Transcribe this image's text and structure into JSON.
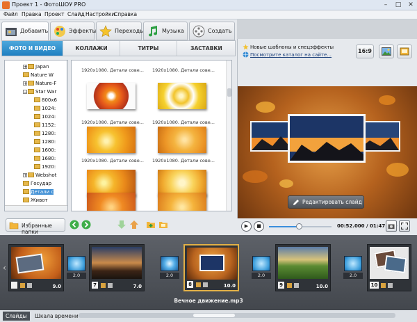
{
  "window": {
    "title": "Проект 1 - ФотоШОУ PRO",
    "min": "–",
    "max": "□",
    "close": "✕"
  },
  "menu": [
    "Файл",
    "Правка",
    "Проект",
    "Слайд",
    "Настройки",
    "Справка"
  ],
  "main_tabs": [
    {
      "label": "Добавить",
      "icon": "add-folder-icon",
      "active": true
    },
    {
      "label": "Эффекты",
      "icon": "palette-icon",
      "active": false
    },
    {
      "label": "Переходы",
      "icon": "star-icon",
      "active": false
    },
    {
      "label": "Музыка",
      "icon": "music-note-icon",
      "active": false
    },
    {
      "label": "Создать",
      "icon": "film-reel-icon",
      "active": false
    }
  ],
  "sub_tabs": [
    {
      "label": "ФОТО И ВИДЕО",
      "active": true
    },
    {
      "label": "КОЛЛАЖИ",
      "active": false
    },
    {
      "label": "ТИТРЫ",
      "active": false
    },
    {
      "label": "ЗАСТАВКИ",
      "active": false
    }
  ],
  "tree": [
    {
      "label": "Japan",
      "indent": 2,
      "toggle": "+"
    },
    {
      "label": "Nature W",
      "indent": 2,
      "toggle": ""
    },
    {
      "label": "Nature-F",
      "indent": 2,
      "toggle": "+"
    },
    {
      "label": "Star War",
      "indent": 2,
      "toggle": "−"
    },
    {
      "label": "800x6",
      "indent": 3,
      "toggle": ""
    },
    {
      "label": "1024:",
      "indent": 3,
      "toggle": ""
    },
    {
      "label": "1024:",
      "indent": 3,
      "toggle": ""
    },
    {
      "label": "1152:",
      "indent": 3,
      "toggle": ""
    },
    {
      "label": "1280:",
      "indent": 3,
      "toggle": ""
    },
    {
      "label": "1280:",
      "indent": 3,
      "toggle": ""
    },
    {
      "label": "1600:",
      "indent": 3,
      "toggle": ""
    },
    {
      "label": "1680:",
      "indent": 3,
      "toggle": ""
    },
    {
      "label": "1920:",
      "indent": 3,
      "toggle": ""
    },
    {
      "label": "Webshot",
      "indent": 2,
      "toggle": "+"
    },
    {
      "label": "Государ",
      "indent": 2,
      "toggle": ""
    },
    {
      "label": "Детали с",
      "indent": 2,
      "toggle": "",
      "selected": true
    },
    {
      "label": "Живот",
      "indent": 2,
      "toggle": ""
    }
  ],
  "thumbs": [
    {
      "caption": "1920x1080. Детали сове...",
      "img": "orange-flower"
    },
    {
      "caption": "1920x1080. Детали сове...",
      "img": "yellow-white-flower"
    },
    {
      "caption": "1920x1080. Детали сове...",
      "img": "yellow-flower"
    },
    {
      "caption": "1920x1080. Детали сове...",
      "img": "orange-lily"
    },
    {
      "caption": "1920x1080. Детали сове...",
      "img": "orange-petals"
    },
    {
      "caption": "1920x1080. Детали сове...",
      "img": "yellow-petals"
    },
    {
      "caption": "",
      "img": "orange-lily-2"
    },
    {
      "caption": "",
      "img": "orange-lily-3"
    }
  ],
  "favorites_label": "Избранные папки",
  "right_header": {
    "line1": "Новые шаблоны и спецэффекты",
    "line2": "Посмотрите каталог на сайте...",
    "ratio_label": "16:9"
  },
  "edit_slide_label": "Редактировать слайд",
  "player": {
    "time": "00:52.000 / 01:47.000",
    "progress": 0.48
  },
  "slides": [
    {
      "num": "",
      "duration": "9.0",
      "img": "autumn-photo-collage",
      "selected": false
    },
    {
      "num": "7",
      "duration": "7.0",
      "img": "sunset-cliffs",
      "selected": false
    },
    {
      "num": "8",
      "duration": "10.0",
      "img": "autumn-leaves-sunset",
      "selected": true
    },
    {
      "num": "9",
      "duration": "10.0",
      "img": "field-flowers",
      "selected": false
    },
    {
      "num": "10",
      "duration": "",
      "img": "photo-stack",
      "selected": false
    }
  ],
  "transitions": [
    "2.0",
    "2.0",
    "2.0",
    "2.0",
    "2.0"
  ],
  "audio_track": "Вечное движение.mp3",
  "bottom_tabs": [
    {
      "label": "Слайды",
      "active": true
    },
    {
      "label": "Шкала времени",
      "active": false
    }
  ],
  "colors": {
    "accent": "#2a8ad0",
    "selection": "#e2b047",
    "timeline_bg": "#4a4e54"
  }
}
